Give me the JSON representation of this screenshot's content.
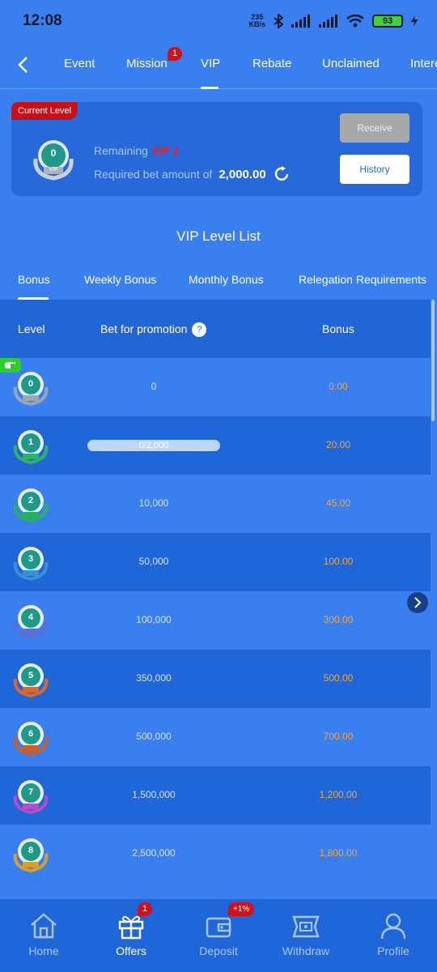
{
  "status": {
    "time": "12:08",
    "netspeed_value": "235",
    "netspeed_unit": "KB/s",
    "battery": "93"
  },
  "topnav": {
    "tabs": [
      {
        "label": "Event"
      },
      {
        "label": "Mission",
        "badge": "1"
      },
      {
        "label": "VIP",
        "active": true
      },
      {
        "label": "Rebate"
      },
      {
        "label": "Unclaimed"
      },
      {
        "label": "Intere"
      }
    ]
  },
  "current_level": {
    "tag": "Current Level",
    "level": "0",
    "medal_text": "VIP",
    "remaining_label": "Remaining",
    "remaining_vip": "VIP 1",
    "required_label": "Required bet amount of",
    "required_amount": "2,000.00",
    "receive_label": "Receive",
    "history_label": "History"
  },
  "list_title": "VIP Level List",
  "subtabs": [
    "Bonus",
    "Weekly Bonus",
    "Monthly Bonus",
    "Relegation Requirements"
  ],
  "table": {
    "headers": {
      "level": "Level",
      "bet": "Bet for promotion",
      "bonus": "Bonus",
      "help": "?"
    },
    "rows": [
      {
        "level": "0",
        "bet": "0",
        "bonus": "0.00",
        "color": "#9aa6b5"
      },
      {
        "level": "1",
        "bet": "0/2,000",
        "progress": 0,
        "bonus": "20.00",
        "color": "#2fb36b"
      },
      {
        "level": "2",
        "bet": "10,000",
        "bonus": "45.00",
        "color": "#27b35c"
      },
      {
        "level": "3",
        "bet": "50,000",
        "bonus": "100.00",
        "color": "#3b8fd6"
      },
      {
        "level": "4",
        "bet": "100,000",
        "bonus": "300.00",
        "color": "#5a6fd6"
      },
      {
        "level": "5",
        "bet": "350,000",
        "bonus": "500.00",
        "color": "#d9692e"
      },
      {
        "level": "6",
        "bet": "500,000",
        "bonus": "700.00",
        "color": "#c85f2a"
      },
      {
        "level": "7",
        "bet": "1,500,000",
        "bonus": "1,200.00",
        "color": "#b050c8"
      },
      {
        "level": "8",
        "bet": "2,500,000",
        "bonus": "1,800.00",
        "color": "#d6a02a"
      }
    ]
  },
  "bottom_nav": [
    {
      "label": "Home",
      "icon": "home-icon"
    },
    {
      "label": "Offers",
      "icon": "gift-icon",
      "active": true,
      "badge": "1"
    },
    {
      "label": "Deposit",
      "icon": "wallet-icon",
      "badge": "+1%"
    },
    {
      "label": "Withdraw",
      "icon": "withdraw-icon"
    },
    {
      "label": "Profile",
      "icon": "profile-icon"
    }
  ]
}
